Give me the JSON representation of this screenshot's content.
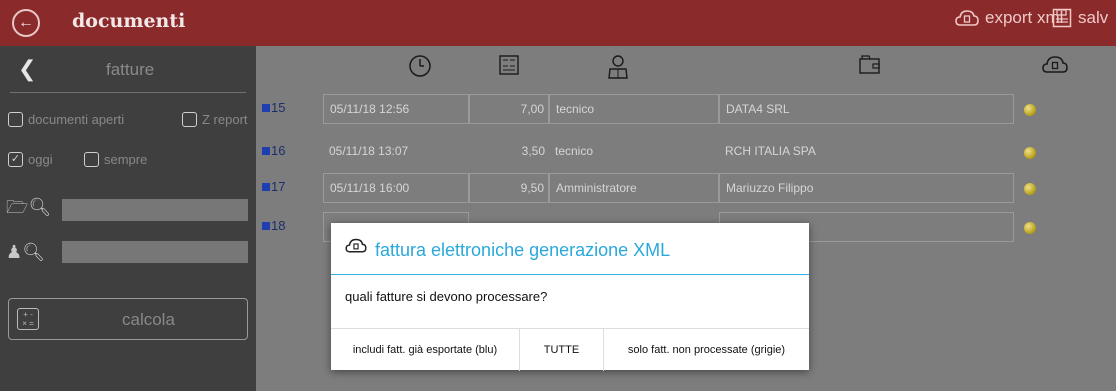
{
  "header": {
    "title": "documenti",
    "export_label": "export xml",
    "save_label": "salv"
  },
  "sidebar": {
    "title": "fatture",
    "chk_open": "documenti aperti",
    "chk_zreport": "Z report",
    "chk_today": "oggi",
    "chk_always": "sempre",
    "calc_label": "calcola"
  },
  "rows": [
    {
      "num": "15",
      "date": "05/11/18 12:56",
      "amount": "7,00",
      "user": "tecnico",
      "client": "DATA4 SRL"
    },
    {
      "num": "16",
      "date": "05/11/18 13:07",
      "amount": "3,50",
      "user": "tecnico",
      "client": "RCH ITALIA SPA"
    },
    {
      "num": "17",
      "date": "05/11/18 16:00",
      "amount": "9,50",
      "user": "Amministratore",
      "client": "Mariuzzo Filippo"
    },
    {
      "num": "18",
      "date": "",
      "amount": "",
      "user": "",
      "client": ""
    }
  ],
  "dialog": {
    "title": "fattura elettroniche generazione XML",
    "message": "quali fatture si devono processare?",
    "btn_include": "includi fatt. già esportate (blu)",
    "btn_all": "TUTTE",
    "btn_unprocessed": "solo fatt. non processate (grigie)"
  }
}
